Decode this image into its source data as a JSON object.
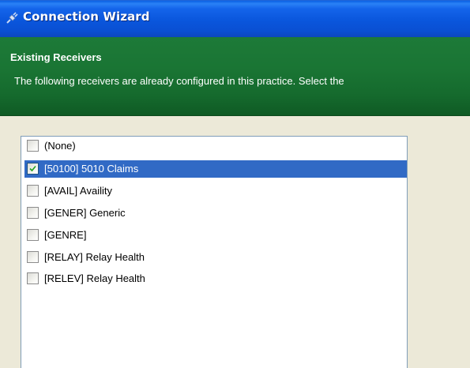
{
  "window": {
    "title": "Connection Wizard"
  },
  "header": {
    "title": "Existing Receivers",
    "description": "The following receivers are already configured in this practice. Select the"
  },
  "receivers": {
    "items": [
      {
        "label": "(None)",
        "checked": false,
        "selected": false
      },
      {
        "label": "[50100] 5010 Claims",
        "checked": true,
        "selected": true
      },
      {
        "label": "[AVAIL] Availity",
        "checked": false,
        "selected": false
      },
      {
        "label": "[GENER] Generic",
        "checked": false,
        "selected": false
      },
      {
        "label": "[GENRE]",
        "checked": false,
        "selected": false
      },
      {
        "label": "[RELAY] Relay Health",
        "checked": false,
        "selected": false
      },
      {
        "label": "[RELEV] Relay Health",
        "checked": false,
        "selected": false
      }
    ]
  },
  "colors": {
    "title_bar": "#0a56dc",
    "header_panel": "#1a7534",
    "selection": "#316ac5",
    "window_face": "#ece9d8"
  },
  "icons": {
    "title_icon": "wizard-plug-icon",
    "check_icon": "checkmark-icon"
  }
}
